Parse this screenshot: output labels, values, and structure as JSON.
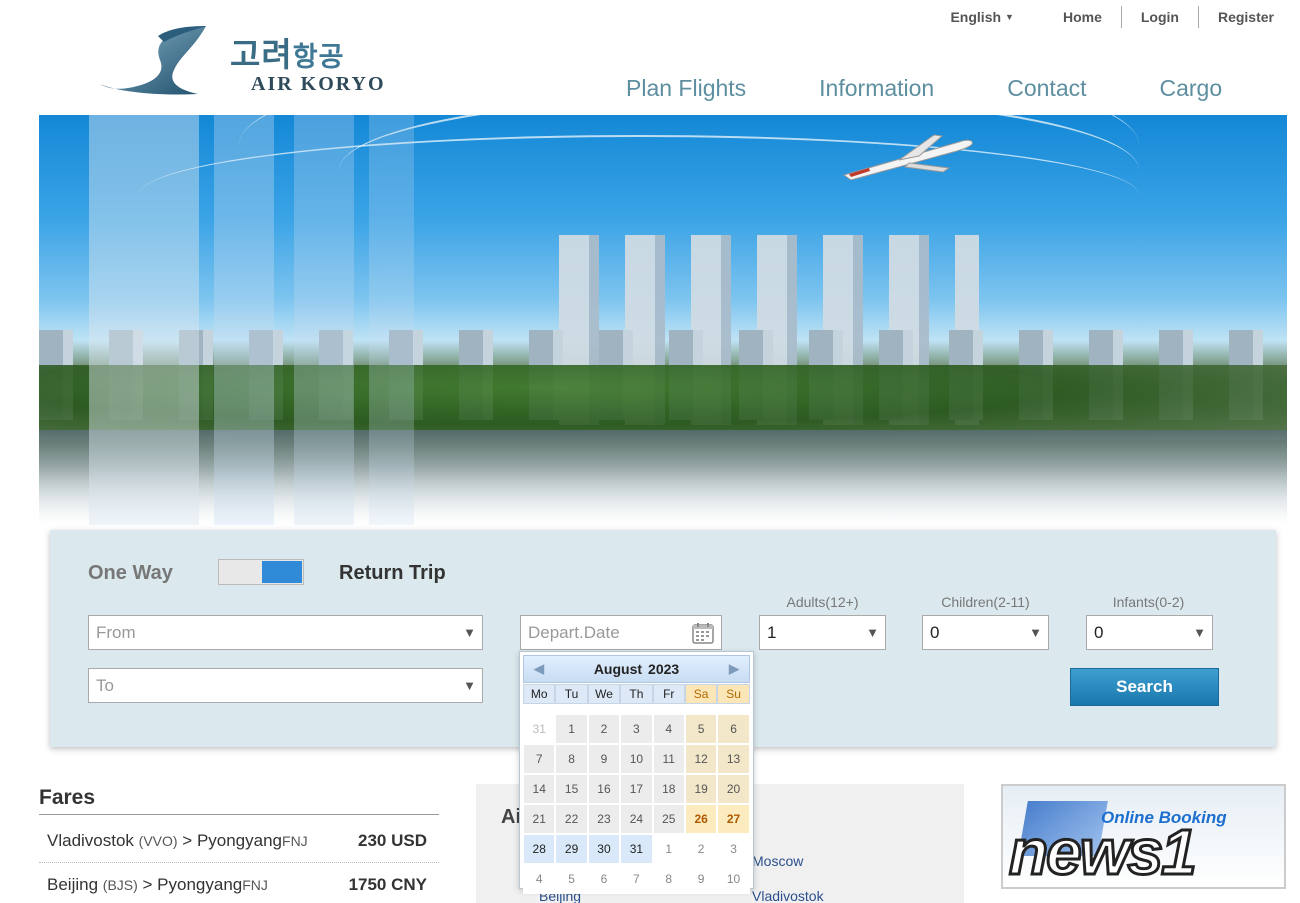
{
  "header": {
    "logo": {
      "korean": "고려",
      "korean_small": "항공",
      "name": "AIR KORYO"
    },
    "language": "English",
    "top_links": [
      "Home",
      "Login",
      "Register"
    ],
    "nav": [
      "Plan Flights",
      "Information",
      "Contact",
      "Cargo"
    ]
  },
  "booking": {
    "one_way_label": "One Way",
    "return_label": "Return Trip",
    "trip_type": "Return Trip",
    "from_placeholder": "From",
    "to_placeholder": "To",
    "depart_placeholder": "Depart.Date",
    "adults": {
      "label": "Adults(12+)",
      "value": "1"
    },
    "children": {
      "label": "Children(2-11)",
      "value": "0"
    },
    "infants": {
      "label": "Infants(0-2)",
      "value": "0"
    },
    "search_label": "Search",
    "colors": {
      "panel": "#dbe9ee",
      "search": "#1a77ad",
      "toggle": "#2f8ad8"
    }
  },
  "datepicker": {
    "month": "August",
    "year": "2023",
    "prev_icon": "◀",
    "next_icon": "▶",
    "weekdays": [
      "Mo",
      "Tu",
      "We",
      "Th",
      "Fr",
      "Sa",
      "Su"
    ],
    "weeks": [
      [
        "31",
        "1",
        "2",
        "3",
        "4",
        "5",
        "6"
      ],
      [
        "7",
        "8",
        "9",
        "10",
        "11",
        "12",
        "13"
      ],
      [
        "14",
        "15",
        "16",
        "17",
        "18",
        "19",
        "20"
      ],
      [
        "21",
        "22",
        "23",
        "24",
        "25",
        "26",
        "27"
      ],
      [
        "28",
        "29",
        "30",
        "31",
        "1",
        "2",
        "3"
      ],
      [
        "4",
        "5",
        "6",
        "7",
        "8",
        "9",
        "10"
      ]
    ]
  },
  "fares": {
    "title": "Fares",
    "rows": [
      {
        "from": "Vladivostok",
        "from_code": "(VVO)",
        "to": "Pyongyang",
        "to_code": "FNJ",
        "price": "230 USD"
      },
      {
        "from": "Beijing",
        "from_code": "(BJS)",
        "to": "Pyongyang",
        "to_code": "FNJ",
        "price": "1750 CNY"
      }
    ]
  },
  "airports": {
    "title_partial": "Ai",
    "cities": [
      "Moscow",
      "Beijing",
      "Vladivostok"
    ]
  },
  "online_booking": {
    "text": "Online Booking"
  },
  "watermark": {
    "text": "news1"
  }
}
